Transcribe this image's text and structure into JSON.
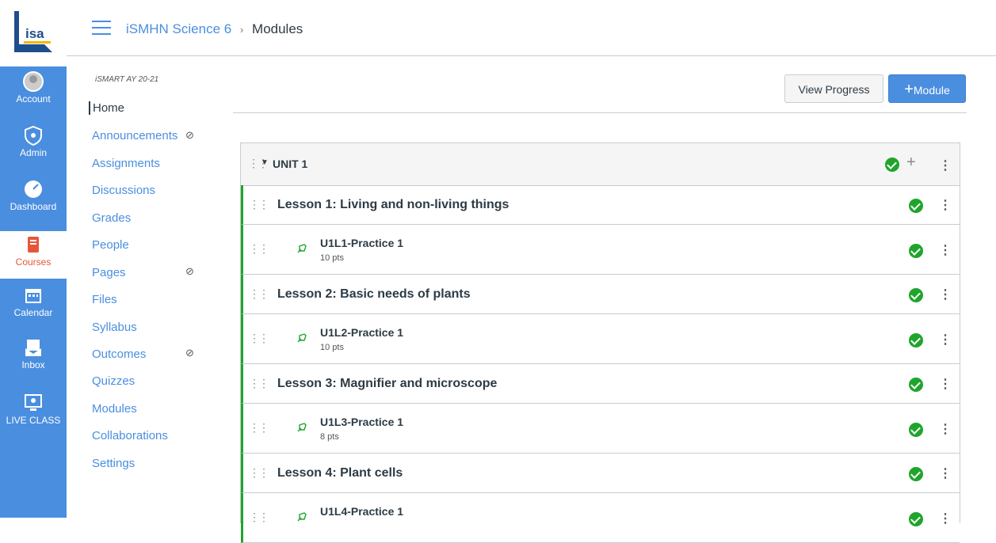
{
  "global_nav": {
    "items": [
      {
        "label": "Account",
        "icon": "account-icon"
      },
      {
        "label": "Admin",
        "icon": "admin-icon"
      },
      {
        "label": "Dashboard",
        "icon": "dashboard-icon"
      },
      {
        "label": "Courses",
        "icon": "courses-icon"
      },
      {
        "label": "Calendar",
        "icon": "calendar-icon"
      },
      {
        "label": "Inbox",
        "icon": "inbox-icon"
      },
      {
        "label": "LIVE CLASS",
        "icon": "live-class-icon"
      }
    ],
    "logo_text": "isa",
    "active": "Courses",
    "colors": {
      "nav_bg": "#4a8ee0",
      "active_text": "#e5563b"
    }
  },
  "header": {
    "course_link": "iSMHN Science 6",
    "separator": "›",
    "current": "Modules"
  },
  "course_nav": {
    "term": "iSMART AY 20-21",
    "items": [
      {
        "label": "Home"
      },
      {
        "label": "Announcements"
      },
      {
        "label": "Assignments"
      },
      {
        "label": "Discussions"
      },
      {
        "label": "Grades"
      },
      {
        "label": "People"
      },
      {
        "label": "Pages"
      },
      {
        "label": "Files"
      },
      {
        "label": "Syllabus"
      },
      {
        "label": "Outcomes"
      },
      {
        "label": "Quizzes"
      },
      {
        "label": "Modules"
      },
      {
        "label": "Collaborations"
      },
      {
        "label": "Settings"
      }
    ],
    "hidden_icon": "eye-slash-icon"
  },
  "toolbar": {
    "view_progress": "View Progress",
    "module_plus": "+",
    "module_label": "Module"
  },
  "module": {
    "title": "UNIT 1",
    "rows": [
      {
        "type": "header",
        "title": "Lesson 1: Living and non-living things"
      },
      {
        "type": "item",
        "title": "U1L1-Practice 1",
        "pts": "10 pts"
      },
      {
        "type": "header",
        "title": "Lesson 2: Basic needs of plants"
      },
      {
        "type": "item",
        "title": "U1L2-Practice 1",
        "pts": "10 pts"
      },
      {
        "type": "header",
        "title": "Lesson 3: Magnifier and microscope"
      },
      {
        "type": "item",
        "title": "U1L3-Practice 1",
        "pts": "8 pts"
      },
      {
        "type": "header",
        "title": "Lesson 4: Plant cells"
      },
      {
        "type": "item",
        "title": "U1L4-Practice 1",
        "pts": ""
      }
    ],
    "colors": {
      "published": "#1fa52c"
    }
  }
}
